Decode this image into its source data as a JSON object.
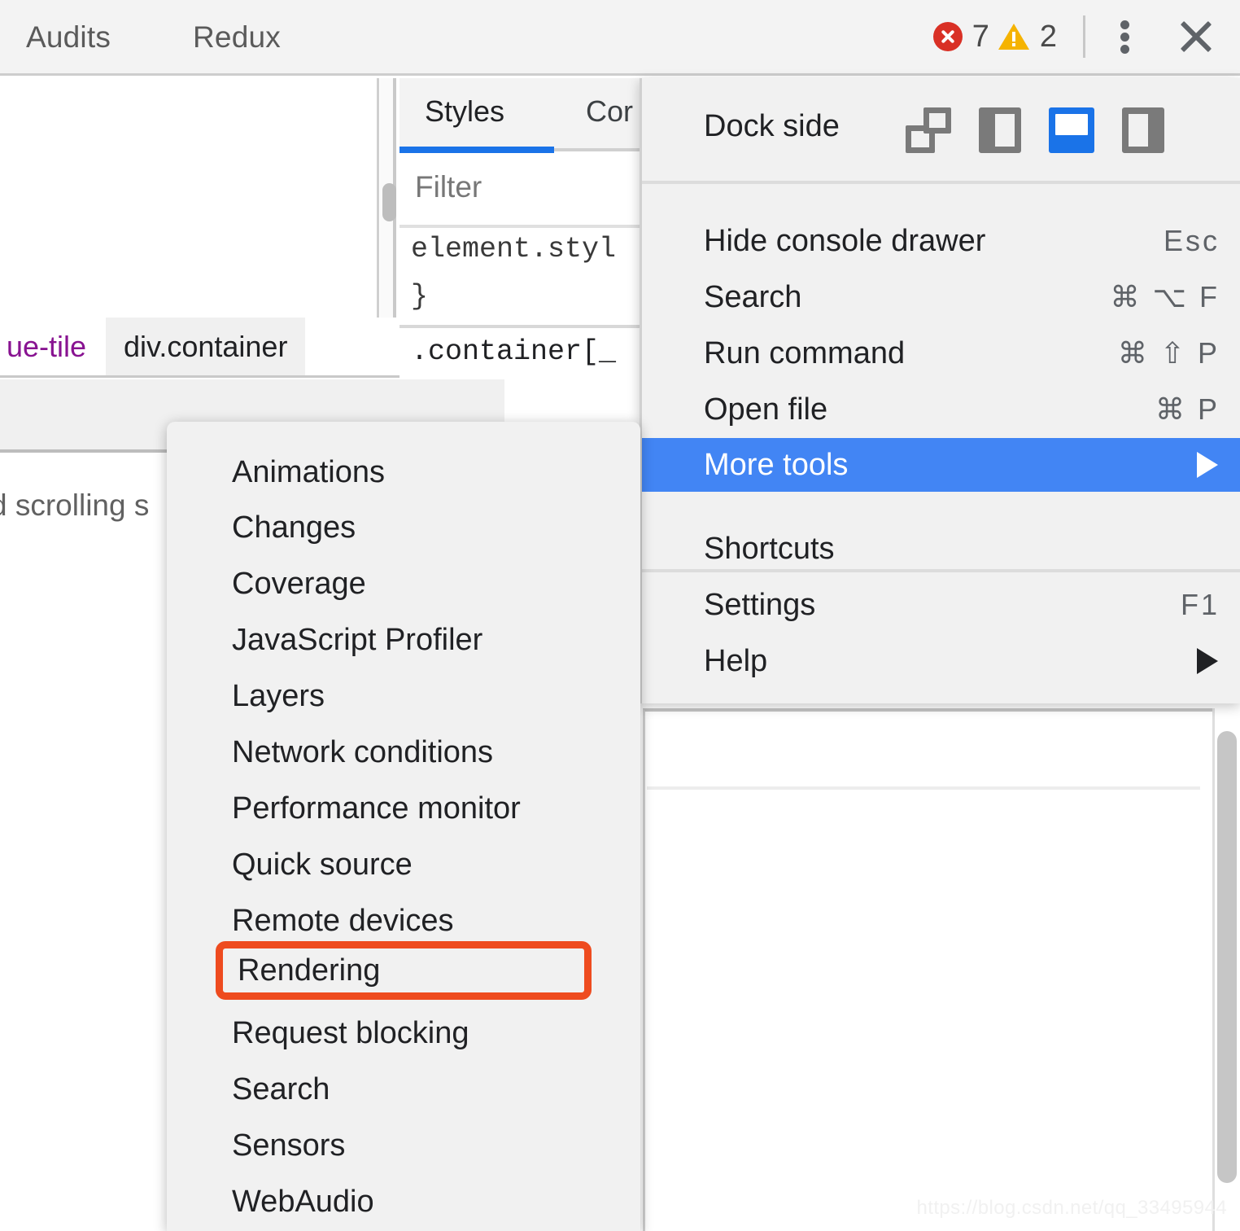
{
  "toolbar": {
    "tabs": [
      {
        "label": "Audits"
      },
      {
        "label": "Redux"
      }
    ],
    "error_count": "7",
    "warning_count": "2",
    "error_icon": "error-circle-icon",
    "warning_icon": "warning-triangle-icon",
    "kebab_icon": "more-vertical-icon",
    "close_icon": "close-icon",
    "colors": {
      "error": "#d93025",
      "warning": "#f5b300",
      "accent": "#1a73e8"
    }
  },
  "styles_panel": {
    "tabs": [
      {
        "label": "Styles",
        "active": true
      },
      {
        "label": "Cor",
        "active": false
      }
    ],
    "filter_placeholder": "Filter",
    "rules": [
      {
        "selector": "element.styl",
        "close": "}"
      },
      {
        "selector": ".container[_"
      }
    ]
  },
  "dom_panel": {
    "breadcrumbs": [
      {
        "label": "ue-tile",
        "selected": false
      },
      {
        "label": "div.container",
        "selected": true
      }
    ],
    "status_text": "d scrolling s"
  },
  "main_menu": {
    "dock": {
      "label": "Dock side",
      "options": [
        {
          "name": "undock-into-separate-window",
          "icon": "undock-icon",
          "active": false
        },
        {
          "name": "dock-to-left",
          "icon": "dock-left-icon",
          "active": false
        },
        {
          "name": "dock-to-bottom",
          "icon": "dock-bottom-icon",
          "active": true
        },
        {
          "name": "dock-to-right",
          "icon": "dock-right-icon",
          "active": false
        }
      ]
    },
    "items": [
      {
        "label": "Hide console drawer",
        "shortcut": "Esc",
        "selected": false,
        "submenu": false
      },
      {
        "label": "Search",
        "shortcut": "⌘ ⌥ F",
        "selected": false,
        "submenu": false
      },
      {
        "label": "Run command",
        "shortcut": "⌘ ⇧ P",
        "selected": false,
        "submenu": false
      },
      {
        "label": "Open file",
        "shortcut": "⌘ P",
        "selected": false,
        "submenu": false
      },
      {
        "label": "More tools",
        "shortcut": "",
        "selected": true,
        "submenu": true
      }
    ],
    "items_bottom": [
      {
        "label": "Shortcuts",
        "shortcut": "",
        "submenu": false
      },
      {
        "label": "Settings",
        "shortcut": "F1",
        "submenu": false
      },
      {
        "label": "Help",
        "shortcut": "",
        "submenu": true
      }
    ]
  },
  "submenu": {
    "title": "More tools",
    "highlight_color": "#ee4b1f",
    "items": [
      {
        "label": "Animations",
        "highlighted": false
      },
      {
        "label": "Changes",
        "highlighted": false
      },
      {
        "label": "Coverage",
        "highlighted": false
      },
      {
        "label": "JavaScript Profiler",
        "highlighted": false
      },
      {
        "label": "Layers",
        "highlighted": false
      },
      {
        "label": "Network conditions",
        "highlighted": false
      },
      {
        "label": "Performance monitor",
        "highlighted": false
      },
      {
        "label": "Quick source",
        "highlighted": false
      },
      {
        "label": "Remote devices",
        "highlighted": false
      },
      {
        "label": "Rendering",
        "highlighted": true
      },
      {
        "label": "Request blocking",
        "highlighted": false
      },
      {
        "label": "Search",
        "highlighted": false
      },
      {
        "label": "Sensors",
        "highlighted": false
      },
      {
        "label": "WebAudio",
        "highlighted": false
      }
    ]
  },
  "watermark": {
    "text": "https://blog.csdn.net/qq_33495944"
  }
}
